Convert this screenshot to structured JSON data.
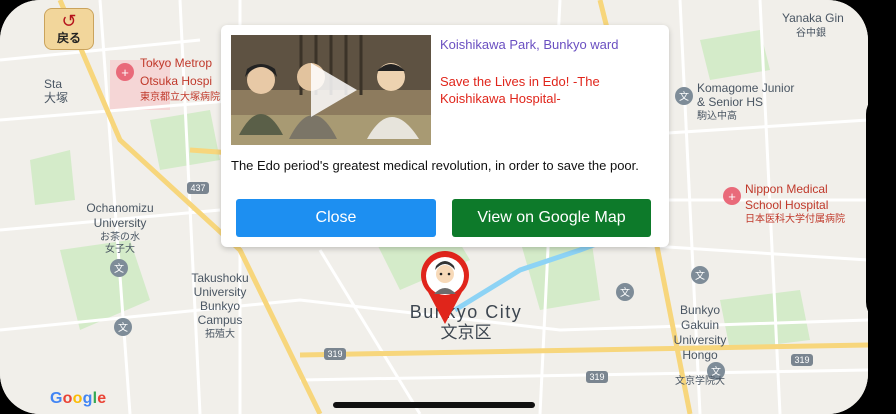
{
  "back_button": {
    "label": "戻る",
    "icon": "return-arrow-icon"
  },
  "map": {
    "labels": {
      "tokyo_metro": "Tokyo Metrop",
      "otsuka_hosp": "Otsuka Hospi",
      "otsuka_hosp_ja": "東京都立大塚病院",
      "station_en": "Sta",
      "station_ja": "大塚",
      "ochanomizu_1": "Ochanomizu",
      "ochanomizu_2": "University",
      "ochanomizu_ja1": "お茶の水",
      "ochanomizu_ja2": "女子大",
      "takushoku_1": "Takushoku",
      "takushoku_2": "University",
      "takushoku_3": "Bunkyo",
      "takushoku_4": "Campus",
      "takushoku_ja": "拓殖大",
      "yanaka": "Yanaka Gin",
      "yanaka_ja": "谷中銀",
      "komagome_1": "Komagome Junior",
      "komagome_2": "& Senior HS",
      "komagome_ja": "駒込中高",
      "nippon_1": "Nippon Medical",
      "nippon_2": "School Hospital",
      "nippon_ja": "日本医科大学付属病院",
      "city_en": "Bunkyo City",
      "city_ja": "文京区",
      "gakuin_1": "Bunkyo",
      "gakuin_2": "Gakuin",
      "gakuin_3": "University",
      "gakuin_4": "Hongo",
      "gakuin_ja": "文京学院大",
      "route_437": "437",
      "route_319a": "319",
      "route_319b": "319",
      "route_319c": "319",
      "school_glyph": "文",
      "hosp_glyph": "+"
    },
    "attribution": "Google"
  },
  "popup": {
    "place": "Koishikawa Park, Bunkyo ward",
    "headline": "Save the Lives in Edo! -The Koishikawa Hospital-",
    "description": "The Edo period's greatest medical revolution, in order to save the poor.",
    "close_label": "Close",
    "google_map_label": "View on Google Map",
    "video_icon": "play-icon"
  },
  "colors": {
    "close_button": "#1d8ff1",
    "google_map_button": "#0d7a2a",
    "place_text": "#6a4fc1",
    "headline_text": "#e0251b",
    "marker": "#e0251b"
  }
}
